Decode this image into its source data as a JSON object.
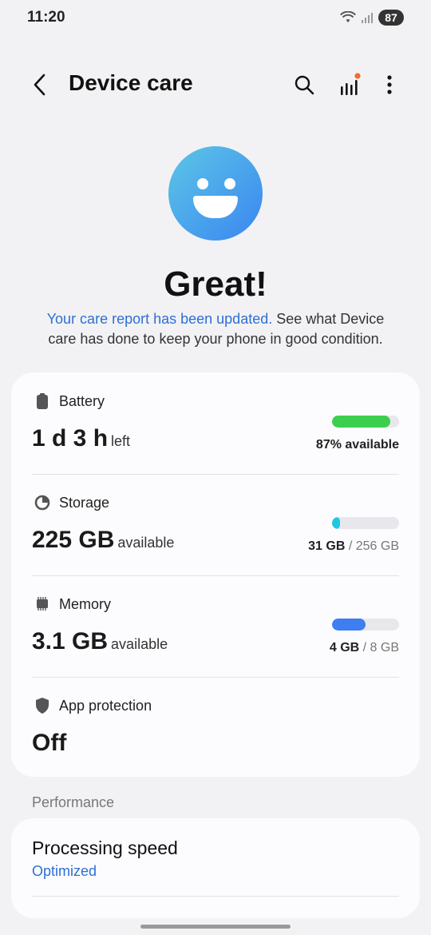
{
  "status_bar": {
    "time": "11:20",
    "battery": "87"
  },
  "header": {
    "title": "Device care"
  },
  "hero": {
    "title": "Great!",
    "link_text": "Your care report has been updated.",
    "body_text": " See what Device care has done to keep your phone in good condition."
  },
  "battery": {
    "label": "Battery",
    "value": "1 d 3 h",
    "unit": "left",
    "percent_text": "87% available",
    "level": 0.87,
    "color": "#3ccf4e"
  },
  "storage": {
    "label": "Storage",
    "value": "225 GB",
    "unit": "available",
    "used": "31 GB",
    "total": " / 256 GB",
    "level": 0.12,
    "color": "#1ec8e0"
  },
  "memory": {
    "label": "Memory",
    "value": "3.1 GB",
    "unit": "available",
    "used": "4 GB",
    "total": " / 8 GB",
    "level": 0.5,
    "color": "#3e7ef0"
  },
  "app_protection": {
    "label": "App protection",
    "value": "Off"
  },
  "performance": {
    "section_label": "Performance",
    "title": "Processing speed",
    "status": "Optimized"
  },
  "icons": {
    "back": "chevron-left-icon",
    "search": "search-icon",
    "report": "bar-chart-icon",
    "more": "more-vertical-icon"
  },
  "colors": {
    "accent": "#2d6fd6",
    "background": "#f2f2f4",
    "badge_dot": "#f26b2a"
  }
}
